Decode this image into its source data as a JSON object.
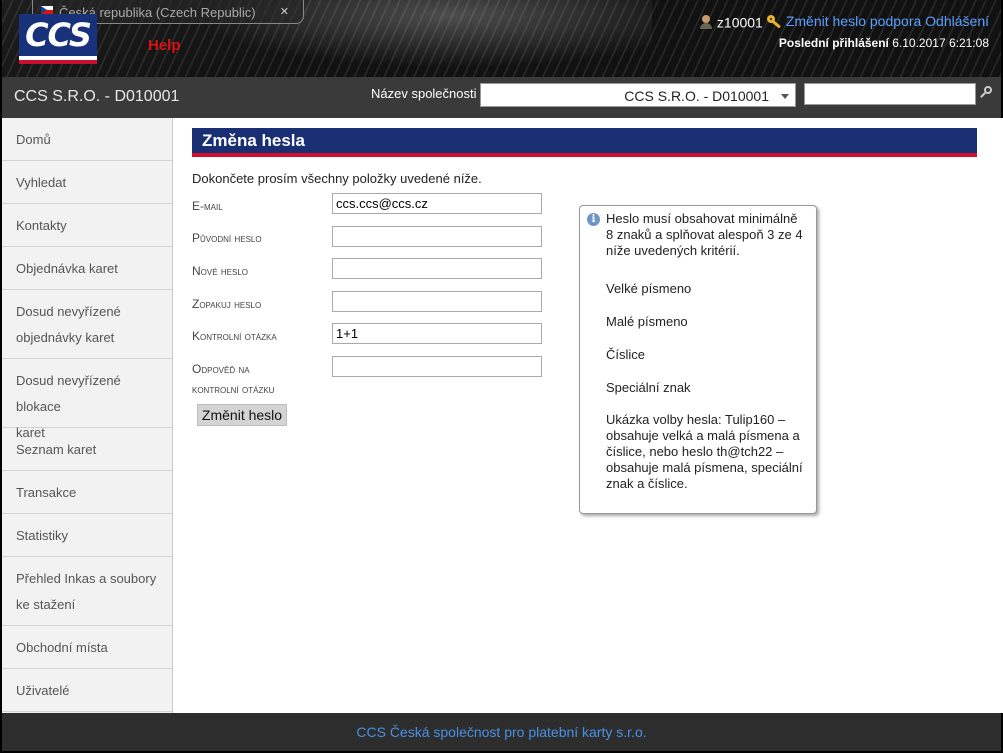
{
  "header": {
    "language": "Česká republika (Czech Republic)",
    "logo_text": "CCS",
    "help": "Help",
    "username": "z10001",
    "change_password": "Změnit heslo",
    "support": "podpora",
    "logout": "Odhlášení",
    "last_login_label": "Poslední přihlášení",
    "last_login_value": "6.10.2017 6:21:08"
  },
  "company_bar": {
    "company_name": "CCS S.R.O. - D010001",
    "company_label": "Název společnosti",
    "selected_company": "CCS S.R.O. - D010001",
    "search_value": ""
  },
  "sidebar": {
    "items": [
      {
        "label": "Domů"
      },
      {
        "label": "Vyhledat"
      },
      {
        "label": "Kontakty"
      },
      {
        "label": "Objednávka karet"
      },
      {
        "label1": "Dosud nevyřízené",
        "label2": "objednávky karet"
      },
      {
        "label1": "Dosud nevyřízené blokace",
        "label2": "karet"
      },
      {
        "label": "Seznam karet"
      },
      {
        "label": "Transakce"
      },
      {
        "label": "Statistiky"
      },
      {
        "label1": "Přehled Inkas a soubory",
        "label2": "ke stažení"
      },
      {
        "label": "Obchodní místa"
      },
      {
        "label": "Uživatelé"
      }
    ]
  },
  "main": {
    "title": "Změna hesla",
    "intro": "Dokončete prosím všechny položky uvedené níže.",
    "fields": {
      "email": {
        "label": "E-mail",
        "value": "ccs.ccs@ccs.cz"
      },
      "old_password": {
        "label": "Původní heslo",
        "value": ""
      },
      "new_password": {
        "label": "Nové heslo",
        "value": ""
      },
      "repeat_password": {
        "label": "Zopakuj heslo",
        "value": ""
      },
      "security_question": {
        "label": "Kontrolní otázka",
        "value": "1+1"
      },
      "security_answer": {
        "label1": "Odpověď na",
        "label2": "kontrolní otázku",
        "value": ""
      }
    },
    "submit": "Změnit heslo"
  },
  "info": {
    "intro": "Heslo musí obsahovat minimálně 8 znaků a splňovat alespoň 3 ze 4 níže uvedených kritérií.",
    "criteria": [
      "Velké písmeno",
      "Malé písmeno",
      "Číslice",
      "Speciální znak"
    ],
    "example": "Ukázka volby hesla: Tulip160 – obsahuje velká a malá písmena a číslice, nebo heslo th@tch22 – obsahuje malá písmena, speciální znak a číslice."
  },
  "footer": {
    "text": "CCS Česká společnost pro platební karty s.r.o."
  },
  "colors": {
    "title_bar": "#1a2f73",
    "accent_red": "#d0102e",
    "link_blue": "#5aa0ff"
  }
}
